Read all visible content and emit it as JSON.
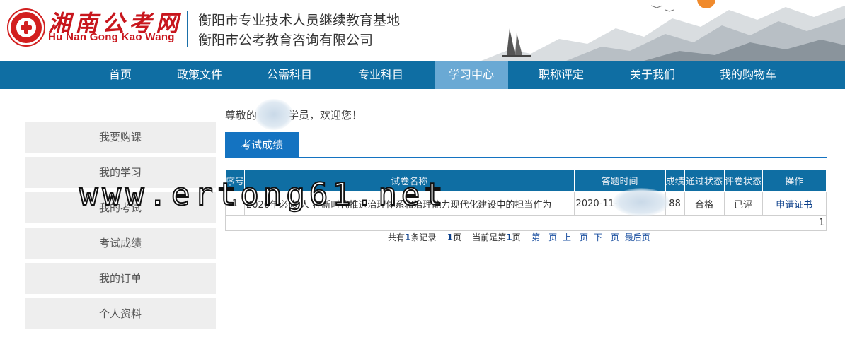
{
  "header": {
    "logo_cn": "湘南公考网",
    "logo_en": "Hu Nan Gong Kao Wang",
    "org_line1": "衡阳市专业技术人员继续教育基地",
    "org_line2": "衡阳市公考教育咨询有限公司"
  },
  "nav": {
    "items": [
      "首页",
      "政策文件",
      "公需科目",
      "专业科目",
      "学习中心",
      "职称评定",
      "关于我们",
      "我的购物车"
    ],
    "active": "学习中心"
  },
  "sidebar": {
    "items": [
      "我要购课",
      "我的学习",
      "我的考试",
      "考试成绩",
      "我的订单",
      "个人资料"
    ]
  },
  "welcome": {
    "prefix": "尊敬的",
    "suffix": "学员，欢迎您！"
  },
  "tab": {
    "label": "考试成绩"
  },
  "table": {
    "headers": [
      "序号",
      "试卷名称",
      "答题时间",
      "成绩",
      "通过状态",
      "评卷状态",
      "操作"
    ],
    "rows": [
      {
        "index": "1",
        "name": "2020年必修 人 在新时代推进治理体系和治理能力现代化建设中的担当作为",
        "time": "2020-11-",
        "score": "88",
        "pass": "合格",
        "review": "已评",
        "action": "申请证书"
      }
    ],
    "count_cell": "1"
  },
  "pager": {
    "t1": "共有",
    "records": "1",
    "t2": "条记录",
    "pages": "1",
    "t3": "页",
    "t4": "当前是第",
    "current": "1",
    "t5": "页",
    "first": "第一页",
    "prev": "上一页",
    "next": "下一页",
    "last": "最后页"
  },
  "watermark": "www.ertong61.net",
  "colors": {
    "nav": "#0f6ea3",
    "nav_active": "#6aa9d4",
    "tab": "#1473c1",
    "brand_red": "#c8161d"
  }
}
